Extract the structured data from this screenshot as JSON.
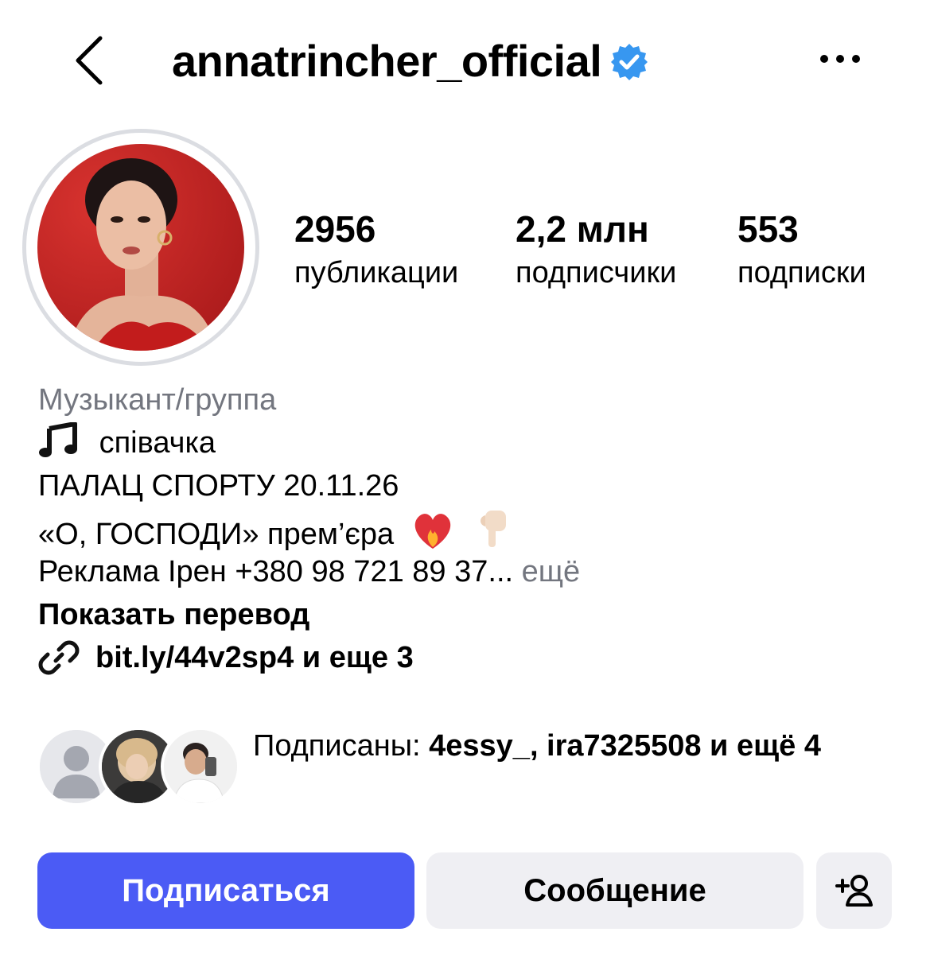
{
  "header": {
    "username": "annatrincher_official",
    "verified": true,
    "back_icon": "chevron-left-icon",
    "more_icon": "more-dots-icon"
  },
  "stats": {
    "posts_value": "2956",
    "posts_label": "публикации",
    "followers_value": "2,2 млн",
    "followers_label": "подписчики",
    "following_value": "553",
    "following_label": "подписки"
  },
  "bio": {
    "category": "Музыкант/группа",
    "line1": "співачка",
    "line2": "ПАЛАЦ СПОРТУ 20.11.26",
    "line3": "«О, ГОСПОДИ» прем’єра",
    "line4": "Реклама Ірен +380 98 721 89 37...",
    "more": "ещё",
    "translate": "Показать перевод",
    "link": "bit.ly/44v2sp4 и еще 3"
  },
  "followed_by": {
    "prefix": "Подписаны:",
    "names": "4essy_, ira7325508",
    "suffix": "и ещё 4"
  },
  "actions": {
    "follow": "Подписаться",
    "message": "Сообщение",
    "add_icon": "add-person-icon"
  },
  "colors": {
    "primary_button": "#4b5bf5",
    "secondary_button": "#efeff3",
    "muted_text": "#73767f",
    "verified_badge": "#3797f0"
  }
}
